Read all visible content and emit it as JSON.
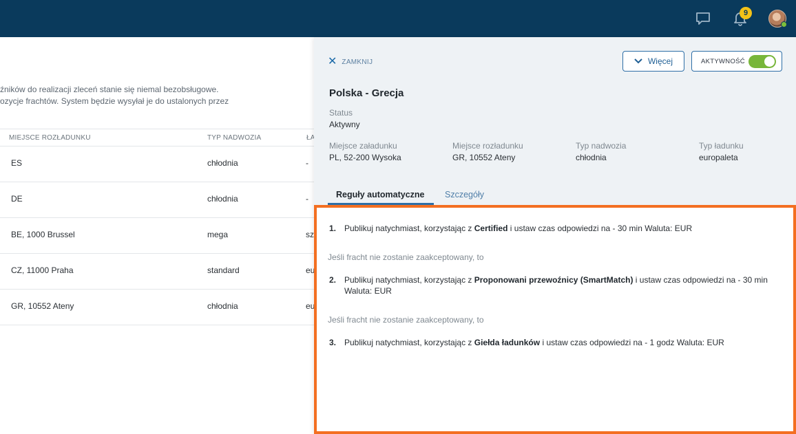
{
  "header": {
    "notification_count": "9",
    "icons": [
      "chat-icon",
      "bell-icon",
      "avatar"
    ]
  },
  "background": {
    "text_line1": "źników do realizacji zleceń stanie się niemal bezobsługowe.",
    "text_line2": "ozycje frachtów. System będzie wysyłał je do ustalonych przez",
    "columns": [
      "MIEJSCE ROZŁADUNKU",
      "TYP NADWOZIA",
      "ŁA"
    ],
    "rows": [
      {
        "unload": "ES",
        "body": "chłodnia",
        "load": "-"
      },
      {
        "unload": "DE",
        "body": "chłodnia",
        "load": "-"
      },
      {
        "unload": "BE, 1000 Brussel",
        "body": "mega",
        "load": "sz"
      },
      {
        "unload": "CZ, 11000 Praha",
        "body": "standard",
        "load": "eu"
      },
      {
        "unload": "GR, 10552 Ateny",
        "body": "chłodnia",
        "load": "eu"
      }
    ]
  },
  "panel": {
    "close_label": "ZAMKNIJ",
    "more_label": "Więcej",
    "activity_label": "AKTYWNOŚĆ",
    "activity_on": true,
    "title": "Polska - Grecja",
    "status_label": "Status",
    "status_value": "Aktywny",
    "fields": [
      {
        "label": "Miejsce załadunku",
        "value": "PL, 52-200 Wysoka"
      },
      {
        "label": "Miejsce rozładunku",
        "value": "GR, 10552 Ateny"
      },
      {
        "label": "Typ nadwozia",
        "value": "chłodnia"
      },
      {
        "label": "Typ ładunku",
        "value": "europaleta"
      }
    ],
    "tabs": [
      {
        "label": "Reguły automatyczne",
        "active": true
      },
      {
        "label": "Szczegóły",
        "active": false
      }
    ],
    "rules": [
      {
        "num": "1.",
        "prefix": "Publikuj natychmiast, korzystając z ",
        "strong": "Certified",
        "suffix": " i ustaw czas odpowiedzi na - 30 min Waluta: EUR"
      },
      {
        "num": "2.",
        "prefix": "Publikuj natychmiast, korzystając z ",
        "strong": "Proponowani przewoźnicy (SmartMatch)",
        "suffix": " i ustaw czas odpowiedzi na - 30 min Waluta: EUR"
      },
      {
        "num": "3.",
        "prefix": "Publikuj natychmiast, korzystając z ",
        "strong": "Giełda ładunków",
        "suffix": " i ustaw czas odpowiedzi na - 1 godz Waluta: EUR"
      }
    ],
    "fallback_note": "Jeśli fracht nie zostanie zaakceptowany, to"
  },
  "colors": {
    "topbar": "#0a3a5c",
    "accent": "#2d6ea6",
    "highlight": "#f36f21",
    "toggle_on": "#78b63a",
    "badge": "#f3c218"
  }
}
